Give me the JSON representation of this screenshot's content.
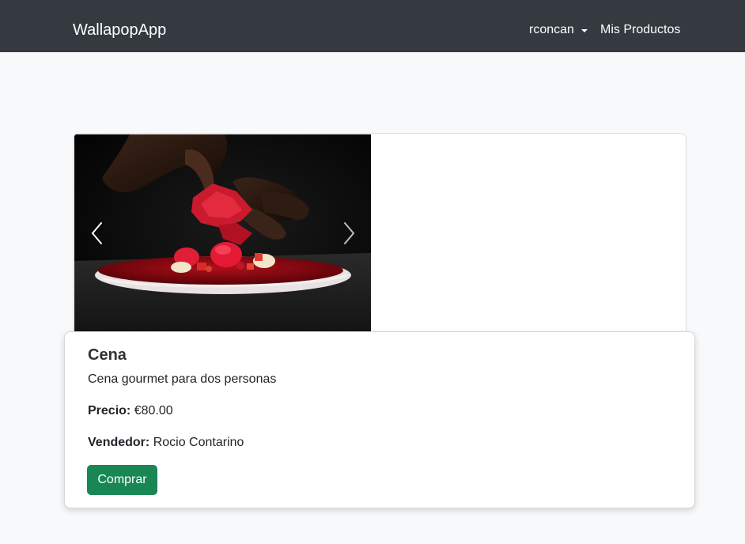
{
  "navbar": {
    "brand": "WallapopApp",
    "user_menu_label": "rconcan",
    "my_products_label": "Mis Productos"
  },
  "carousel": {
    "image_alt": "Cena gourmet",
    "prev_icon": "chevron-left-icon",
    "next_icon": "chevron-right-icon"
  },
  "product": {
    "title": "Cena",
    "description": "Cena gourmet para dos personas",
    "price_label": "Precio:",
    "price_value": "€80.00",
    "seller_label": "Vendedor:",
    "seller_value": "Rocio Contarino",
    "buy_label": "Comprar"
  },
  "colors": {
    "navbar_bg": "#343a40",
    "page_bg": "#f8f9fa",
    "buy_button": "#198754"
  }
}
